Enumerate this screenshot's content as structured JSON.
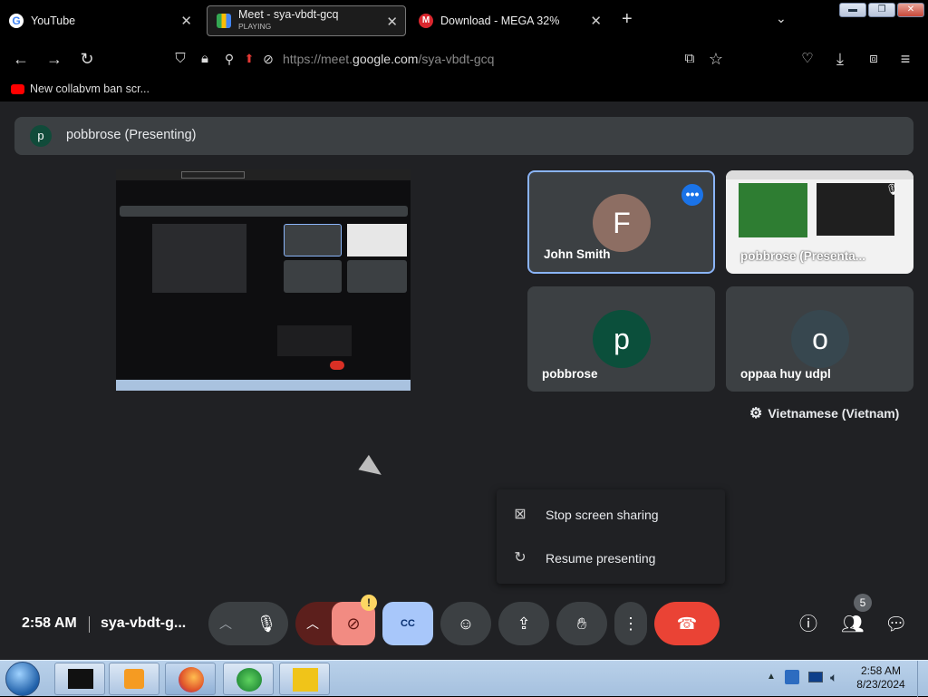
{
  "browser": {
    "tabs": [
      {
        "title": "YouTube",
        "subtitle": "",
        "favicon": "google-g-icon"
      },
      {
        "title": "Meet - sya-vbdt-gcq",
        "subtitle": "PLAYING",
        "favicon": "meet-icon"
      },
      {
        "title": "Download - MEGA 32%",
        "subtitle": "",
        "favicon": "mega-icon"
      }
    ],
    "new_tab": "+",
    "url_prefix": "https://meet.",
    "url_domain": "google.com",
    "url_path": "/sya-vbdt-gcq",
    "bookmark": "New collabvm ban scr..."
  },
  "meet": {
    "presenting_initial": "p",
    "presenting_label": "pobbrose (Presenting)",
    "tiles": [
      {
        "name": "John Smith",
        "initial": "F",
        "avatar_color": "#8d6e63"
      },
      {
        "name": "pobbrose (Presenta...",
        "initial": "",
        "avatar_color": ""
      },
      {
        "name": "pobbrose",
        "initial": "p",
        "avatar_color": "#0b4f3b"
      },
      {
        "name": "oppaa huy udpl",
        "initial": "o",
        "avatar_color": "#37474f"
      }
    ],
    "caption_language": "Vietnamese (Vietnam)",
    "menu": [
      {
        "label": "Stop screen sharing",
        "icon": "close-box-icon"
      },
      {
        "label": "Resume presenting",
        "icon": "refresh-icon"
      }
    ],
    "time": "2:58 AM",
    "meeting_code": "sya-vbdt-g...",
    "participant_count": "5",
    "alert_badge": "!"
  },
  "taskbar": {
    "clock_time": "2:58 AM",
    "clock_date": "8/23/2024"
  },
  "colors": {
    "accent_blue": "#8ab4f8",
    "end_call_red": "#ea4335",
    "cc_active": "#a8c7fa",
    "camera_off": "#f28b82"
  }
}
